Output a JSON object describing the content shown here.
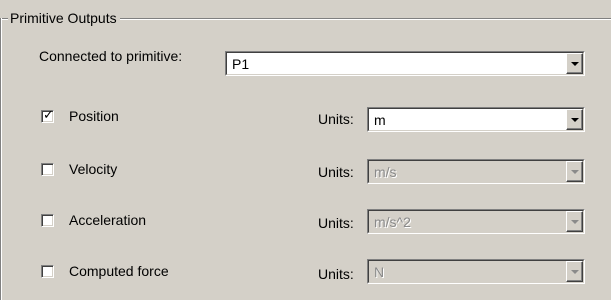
{
  "group": {
    "title": "Primitive Outputs"
  },
  "connected": {
    "label": "Connected to primitive:",
    "value": "P1"
  },
  "units_label": "Units:",
  "rows": [
    {
      "name": "Position",
      "checked": true,
      "units": "m",
      "enabled": true
    },
    {
      "name": "Velocity",
      "checked": false,
      "units": "m/s",
      "enabled": false
    },
    {
      "name": "Acceleration",
      "checked": false,
      "units": "m/s^2",
      "enabled": false
    },
    {
      "name": "Computed force",
      "checked": false,
      "units": "N",
      "enabled": false
    }
  ],
  "icons": {
    "dropdown": "chevron-down-icon",
    "check": "checkmark-icon"
  }
}
